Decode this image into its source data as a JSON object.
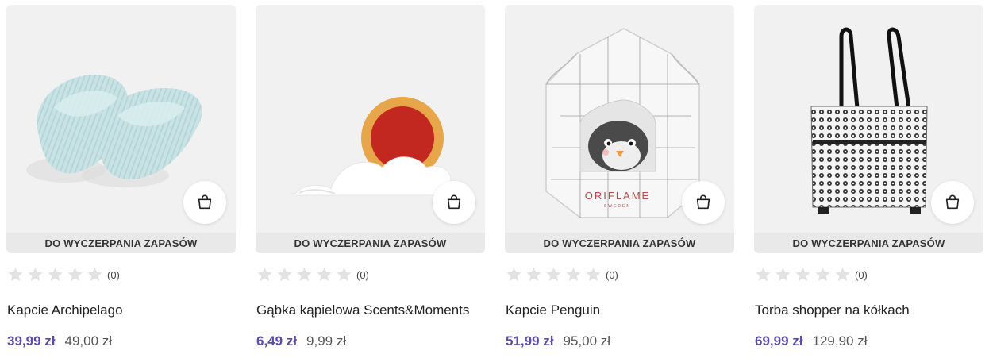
{
  "theme": {
    "accent": "#5a4ca7",
    "star_color": "#e2e2e2",
    "card_bg": "#f1f1f2"
  },
  "products": [
    {
      "name": "Kapcie Archipelago",
      "badge": "DO WYCZERPANIA ZAPASÓW",
      "rating_count": "(0)",
      "rating": 0,
      "price": "39,99 zł",
      "old_price": "49,00 zł",
      "cart_icon": "shopping-bag-icon",
      "image": "slippers"
    },
    {
      "name": "Gąbka kąpielowa Scents&Moments",
      "badge": "DO WYCZERPANIA ZAPASÓW",
      "rating_count": "(0)",
      "rating": 0,
      "price": "6,49 zł",
      "old_price": "9,99 zł",
      "cart_icon": "shopping-bag-icon",
      "image": "sponge"
    },
    {
      "name": "Kapcie Penguin",
      "badge": "DO WYCZERPANIA ZAPASÓW",
      "rating_count": "(0)",
      "rating": 0,
      "price": "51,99 zł",
      "old_price": "95,00 zł",
      "cart_icon": "shopping-bag-icon",
      "image": "penguin-box",
      "box_text": "ORIFLAME",
      "box_subtext": "SWEDEN"
    },
    {
      "name": "Torba shopper na kółkach",
      "badge": "DO WYCZERPANIA ZAPASÓW",
      "rating_count": "(0)",
      "rating": 0,
      "price": "69,99 zł",
      "old_price": "129,90 zł",
      "cart_icon": "shopping-bag-icon",
      "image": "shopper-bag"
    }
  ]
}
